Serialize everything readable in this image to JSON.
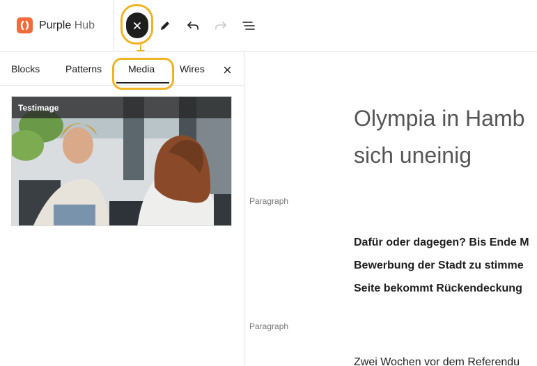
{
  "app": {
    "brand_first": "Purple",
    "brand_second": " Hub"
  },
  "toolbar": {
    "icons": [
      "close-icon",
      "pencil-icon",
      "undo-icon",
      "redo-icon",
      "list-view-icon"
    ]
  },
  "sidebar": {
    "tabs": [
      {
        "label": "Blocks"
      },
      {
        "label": "Patterns"
      },
      {
        "label": "Media"
      },
      {
        "label": "Wires"
      }
    ],
    "media": {
      "title": "Testimage"
    }
  },
  "editor": {
    "heading_lines": [
      "Olympia in Hamb",
      "sich uneinig"
    ],
    "block_label_1": "Paragraph",
    "lead_lines": [
      "Dafür oder dagegen? Bis Ende M",
      "Bewerbung der Stadt zu stimme",
      "Seite bekommt Rückendeckung"
    ],
    "block_label_2": "Paragraph",
    "body_line": "Zwei Wochen vor dem Referendu"
  },
  "colors": {
    "highlight": "#f0b323",
    "brand": "#f26b38",
    "active_tab": "#1e1e1e"
  }
}
